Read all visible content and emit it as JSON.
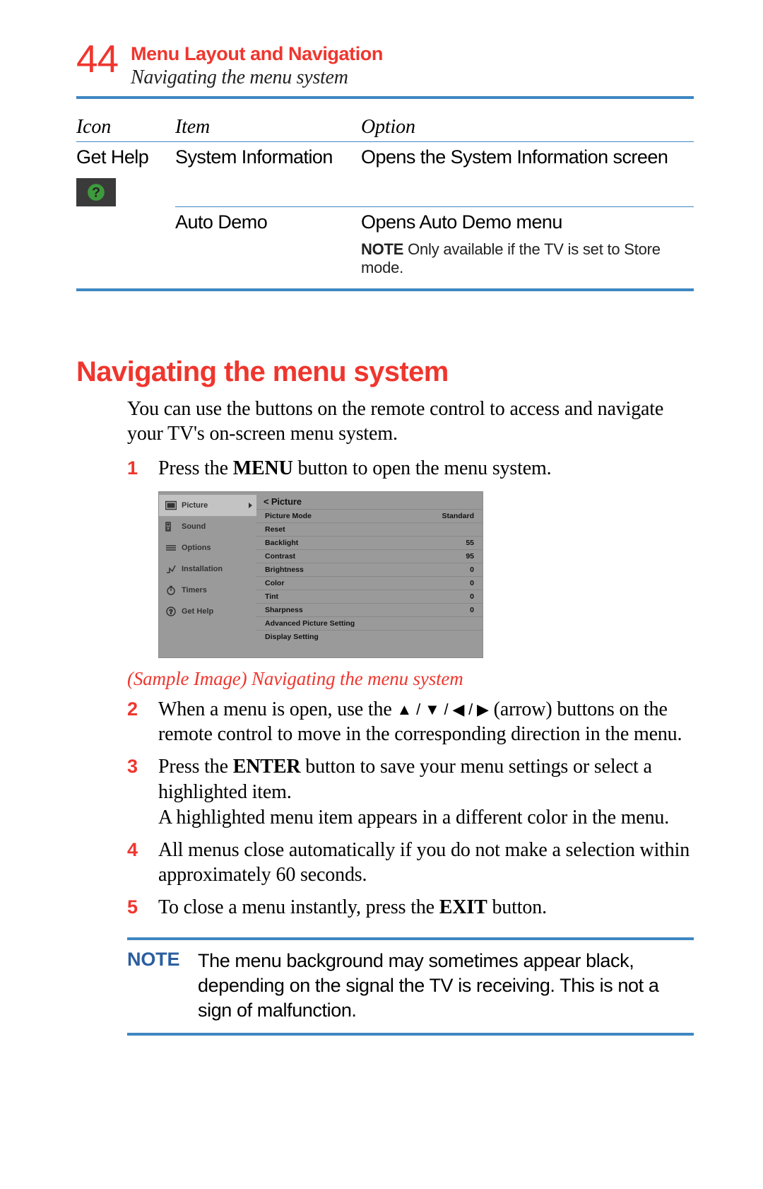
{
  "header": {
    "page_number": "44",
    "chapter_title": "Menu Layout and Navigation",
    "subtitle": "Navigating the menu system"
  },
  "table": {
    "headers": {
      "icon": "Icon",
      "item": "Item",
      "option": "Option"
    },
    "row1": {
      "icon_label": "Get Help",
      "item": "System Information",
      "option": "Opens the System Information screen"
    },
    "row2": {
      "item": "Auto Demo",
      "option": "Opens Auto Demo menu",
      "note_label": "NOTE",
      "note_text": "  Only available if the TV is set to Store mode."
    }
  },
  "section": {
    "heading": "Navigating the menu system",
    "intro": "You can use the buttons on the remote control to access and navigate your TV's on-screen menu system."
  },
  "steps": {
    "s1": {
      "num": "1",
      "pre": "Press the ",
      "bold": "MENU",
      "post": " button to open the menu system."
    },
    "s2": {
      "num": "2",
      "pre": "When a menu is open, use the ",
      "arrows": "▲ / ▼ / ◀ / ▶",
      "post": " (arrow) buttons on the remote control to move in the corresponding direction in the menu."
    },
    "s3": {
      "num": "3",
      "pre": "Press the ",
      "bold": "ENTER",
      "mid": " button to save your menu settings or select a highlighted item.",
      "line2": "A highlighted menu item appears in a different color in the menu."
    },
    "s4": {
      "num": "4",
      "text": "All menus close automatically if you do not make a selection within approximately 60 seconds."
    },
    "s5": {
      "num": "5",
      "pre": "To close a menu instantly, press the ",
      "bold": "EXIT",
      "post": " button."
    }
  },
  "caption": "(Sample Image) Navigating the menu system",
  "note_block": {
    "label": "NOTE",
    "text": "The menu background may sometimes appear black, depending on the signal the TV is receiving. This is not a sign of malfunction."
  },
  "tv": {
    "side": {
      "picture": "Picture",
      "sound": "Sound",
      "options": "Options",
      "installation": "Installation",
      "timers": "Timers",
      "gethelp": "Get Help"
    },
    "title": "<  Picture",
    "rows": {
      "r0": {
        "label": "Picture  Mode",
        "value": "Standard"
      },
      "r1": {
        "label": "Reset",
        "value": ""
      },
      "r2": {
        "label": "Backlight",
        "value": "55"
      },
      "r3": {
        "label": "Contrast",
        "value": "95"
      },
      "r4": {
        "label": "Brightness",
        "value": "0"
      },
      "r5": {
        "label": "Color",
        "value": "0"
      },
      "r6": {
        "label": "Tint",
        "value": "0"
      },
      "r7": {
        "label": "Sharpness",
        "value": "0"
      },
      "r8": {
        "label": "Advanced Picture Setting",
        "value": ""
      },
      "r9": {
        "label": "Display Setting",
        "value": ""
      }
    }
  }
}
